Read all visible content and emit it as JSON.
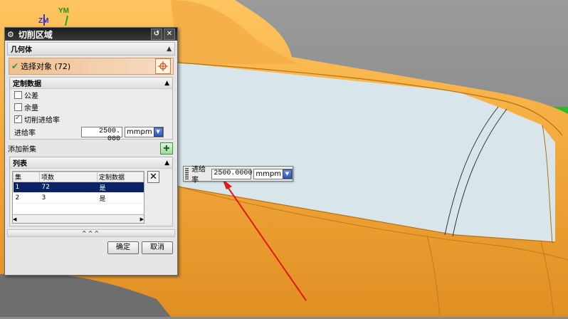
{
  "axes": {
    "zm": "ZM",
    "ym": "YM"
  },
  "dialog": {
    "title": "切削区域",
    "title_icons": [
      "gear-icon",
      "reset-icon",
      "close-icon"
    ],
    "geometry": {
      "header": "几何体",
      "select_object": "选择对象 (72)"
    },
    "custom_data": {
      "header": "定制数据",
      "tolerance": "公差",
      "stock": "余量",
      "cut_feed": "切削进给率",
      "feed_label": "进给率",
      "feed_value": "2500. 000",
      "unit": "mmpm"
    },
    "add_new_set": "添加新集",
    "list": {
      "header": "列表",
      "columns": [
        "集",
        "项数",
        "定制数据"
      ],
      "rows": [
        {
          "set": "1",
          "count": "72",
          "custom": "是"
        },
        {
          "set": "2",
          "count": "3",
          "custom": "是"
        }
      ]
    },
    "expander": "^^^",
    "ok": "确定",
    "cancel": "取消"
  },
  "floating_feed": {
    "label": "进给率",
    "value": "2500.0000",
    "unit": "mmpm"
  },
  "colors": {
    "part_orange": "#f2a73a",
    "face_blue": "#d8e6ec",
    "arrow_red": "#e01a1a",
    "selection_navy": "#0c2366"
  }
}
